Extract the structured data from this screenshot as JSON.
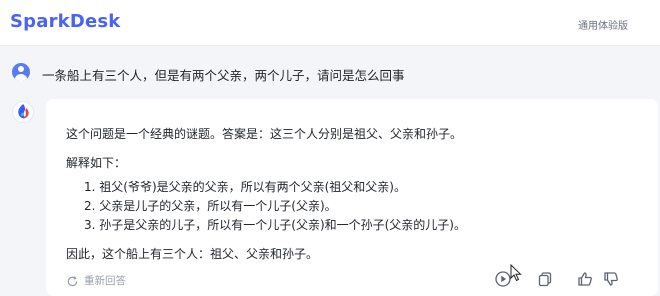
{
  "header": {
    "logo": "SparkDesk",
    "version_link": "通用体验版"
  },
  "question": {
    "text": "一条船上有三个人，但是有两个父亲，两个儿子，请问是怎么回事"
  },
  "answer": {
    "intro": "这个问题是一个经典的谜题。答案是：这三个人分别是祖父、父亲和孙子。",
    "explain_heading": "解释如下：",
    "items": [
      "1. 祖父(爷爷)是父亲的父亲，所以有两个父亲(祖父和父亲)。",
      "2. 父亲是儿子的父亲，所以有一个儿子(父亲)。",
      "3. 孙子是父亲的儿子，所以有一个儿子(父亲)和一个孙子(父亲的儿子)。"
    ],
    "conclusion": "因此，这个船上有三个人：祖父、父亲和孙子。"
  },
  "actions": {
    "regenerate_label": "重新回答"
  },
  "icons": {
    "user_avatar": "user-avatar-icon",
    "bot_avatar": "sparkdesk-logo-icon",
    "regenerate": "refresh-icon",
    "play": "play-icon",
    "copy": "copy-icon",
    "like": "thumbs-up-icon",
    "dislike": "thumbs-down-icon"
  },
  "colors": {
    "brand": "#4a63f2",
    "background": "#f3f5f9",
    "card": "#ffffff",
    "muted": "#9aa1ad"
  }
}
